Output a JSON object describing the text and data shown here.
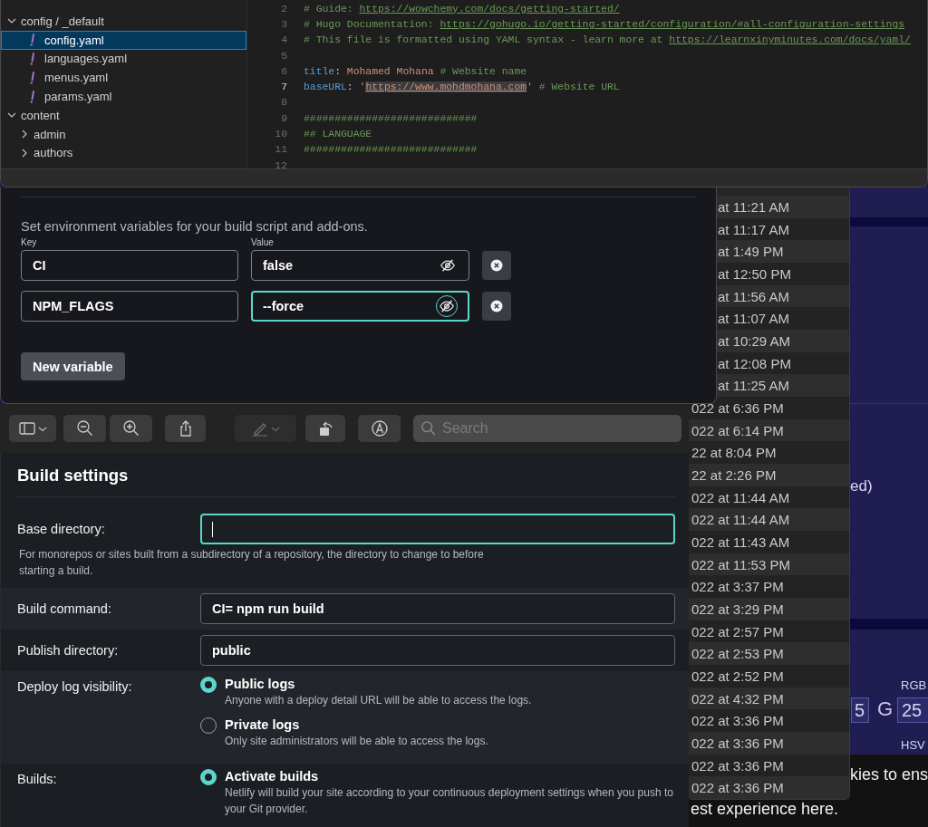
{
  "editor": {
    "tree": [
      {
        "kind": "folder",
        "label": "config / _default",
        "expanded": true,
        "children": [
          {
            "kind": "file",
            "label": "config.yaml",
            "selected": true
          },
          {
            "kind": "file",
            "label": "languages.yaml",
            "selected": false
          },
          {
            "kind": "file",
            "label": "menus.yaml",
            "selected": false
          },
          {
            "kind": "file",
            "label": "params.yaml",
            "selected": false
          }
        ]
      },
      {
        "kind": "folder",
        "label": "content",
        "expanded": true,
        "children": [
          {
            "kind": "folder",
            "label": "admin",
            "expanded": false
          },
          {
            "kind": "folder",
            "label": "authors",
            "expanded": false
          }
        ]
      }
    ],
    "lines": [
      {
        "number": "2",
        "current": false,
        "segments": [
          {
            "kind": "comment",
            "text": "# Guide: "
          },
          {
            "kind": "link",
            "text": "https://wowchemy.com/docs/getting-started/"
          }
        ]
      },
      {
        "number": "3",
        "current": false,
        "segments": [
          {
            "kind": "comment",
            "text": "# Hugo Documentation: "
          },
          {
            "kind": "link",
            "text": "https://gohugo.io/getting-started/configuration/#all-configuration-settings"
          }
        ]
      },
      {
        "number": "4",
        "current": false,
        "segments": [
          {
            "kind": "comment",
            "text": "# This file is formatted using YAML syntax - learn more at "
          },
          {
            "kind": "link",
            "text": "https://learnxinyminutes.com/docs/yaml/"
          }
        ]
      },
      {
        "number": "5",
        "current": false
      },
      {
        "number": "6",
        "current": false,
        "segments": [
          {
            "kind": "key",
            "text": "title"
          },
          {
            "kind": "plain",
            "text": ": "
          },
          {
            "kind": "string",
            "text": "Mohamed Mohana"
          },
          {
            "kind": "comment",
            "text": " # Website name"
          }
        ]
      },
      {
        "number": "7",
        "current": true,
        "segments": [
          {
            "kind": "key",
            "text": "baseURL"
          },
          {
            "kind": "plain",
            "text": ": "
          },
          {
            "kind": "string",
            "text": "'"
          },
          {
            "kind": "string-link",
            "text": "https://www.mohdmohana.com"
          },
          {
            "kind": "string",
            "text": "'"
          },
          {
            "kind": "comment",
            "text": " # Website URL"
          }
        ]
      },
      {
        "number": "8",
        "current": false
      },
      {
        "number": "9",
        "current": false,
        "segments": [
          {
            "kind": "comment",
            "text": "############################"
          }
        ]
      },
      {
        "number": "10",
        "current": false,
        "segments": [
          {
            "kind": "comment",
            "text": "## LANGUAGE"
          }
        ]
      },
      {
        "number": "11",
        "current": false,
        "segments": [
          {
            "kind": "comment",
            "text": "############################"
          }
        ]
      },
      {
        "number": "12",
        "current": false
      }
    ]
  },
  "environment": {
    "description": "Set environment variables for your build script and add-ons.",
    "key_label": "Key",
    "value_label": "Value",
    "variables": [
      {
        "key": "CI",
        "value": "false",
        "focused": false
      },
      {
        "key": "NPM_FLAGS",
        "value": "--force",
        "focused": true
      }
    ],
    "new_button": "New variable"
  },
  "viewer_toolbar": {
    "search": {
      "placeholder": "Search"
    }
  },
  "timestamps": [
    "at 11:21 AM",
    "at 11:17 AM",
    "at 1:49 PM",
    "at 12:50 PM",
    "at 11:56 AM",
    "at 11:07 AM",
    "at 10:29 AM",
    "at 12:08 PM",
    "at 11:25 AM",
    "022 at 6:36 PM",
    "022 at 6:14 PM",
    "22 at 8:04 PM",
    "22 at 2:26 PM",
    "022 at 11:44 AM",
    "022 at 11:44 AM",
    "022 at 11:43 AM",
    "022 at 11:53 PM",
    "022 at 3:37 PM",
    "022 at 3:29 PM",
    "022 at 2:57 PM",
    "022 at 2:53 PM",
    "022 at 2:52 PM",
    "022 at 4:32 PM",
    "022 at 3:36 PM",
    "022 at 3:36 PM",
    "022 at 3:36 PM",
    "022 at 3:36 PM"
  ],
  "background_page": {
    "fragment": "ed)",
    "rgb_label": "RGB",
    "r_value": "5",
    "g_label": "G",
    "g_value": "25",
    "hsv_label": "HSV",
    "cookie_line_1": "kies to ens",
    "cookie_line_2": "est experience here."
  },
  "build_settings": {
    "title": "Build settings",
    "rows": [
      {
        "kind": "input",
        "label": "Base directory:",
        "value": "",
        "focused": true,
        "help": "For monorepos or sites built from a subdirectory of a repository, the directory to change to before starting a build."
      },
      {
        "kind": "input",
        "label": "Build command:",
        "value": "CI= npm run build",
        "focused": false
      },
      {
        "kind": "input",
        "label": "Publish directory:",
        "value": "public",
        "focused": false
      },
      {
        "kind": "radio",
        "label": "Deploy log visibility:",
        "options": [
          {
            "title": "Public logs",
            "description": "Anyone with a deploy detail URL will be able to access the logs.",
            "selected": true
          },
          {
            "title": "Private logs",
            "description": "Only site administrators will be able to access the logs.",
            "selected": false
          }
        ]
      },
      {
        "kind": "radio",
        "label": "Builds:",
        "options": [
          {
            "title": "Activate builds",
            "description": "Netlify will build your site according to your continuous deployment settings when you push to your Git provider.",
            "selected": true
          }
        ]
      }
    ]
  }
}
